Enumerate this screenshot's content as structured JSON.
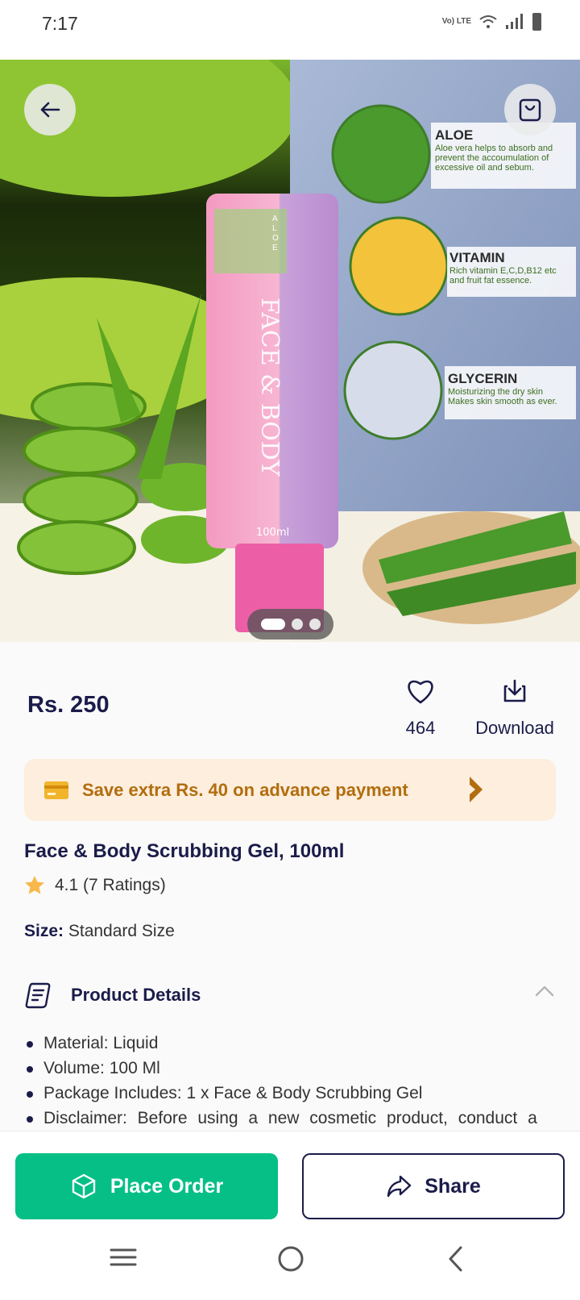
{
  "status_bar": {
    "time": "7:17",
    "network_label": "Vo) LTE"
  },
  "hero": {
    "panel_labels": [
      {
        "title": "ALOE",
        "desc_1": "Aloe vera helps to absorb and",
        "desc_2": "prevent the accoumulation of",
        "desc_3": "excessive oil and sebum."
      },
      {
        "title": "VITAMIN",
        "desc_1": "Rich vitamin E,C,D,B12 etc",
        "desc_2": "and fruit fat essence.",
        "desc_3": ""
      },
      {
        "title": "GLYCERIN",
        "desc_1": "Moisturizing the dry skin",
        "desc_2": "Makes skin smooth as ever.",
        "desc_3": ""
      }
    ],
    "tube_text": {
      "brand": "ALOE",
      "line_1": "FACE",
      "line_2": "&",
      "line_3": "BODY",
      "volume": "100ml"
    },
    "carousel": {
      "total": 3,
      "active_index": 0
    }
  },
  "product": {
    "price": "Rs. 250",
    "wishlist_count": "464",
    "download_label": "Download",
    "promo_text": "Save extra Rs. 40 on advance payment",
    "title": "Face & Body Scrubbing Gel, 100ml",
    "rating_text": "4.1 (7 Ratings)",
    "size_label": "Size:",
    "size_value": "Standard Size"
  },
  "details": {
    "heading": "Product Details",
    "items": [
      "Material: Liquid",
      "Volume: 100 Ml",
      "Package Includes: 1 x Face & Body Scrubbing Gel",
      "Disclaimer: Before using a new cosmetic product, conduct a"
    ]
  },
  "actions": {
    "place_order": "Place Order",
    "share": "Share"
  },
  "colors": {
    "primary_dark": "#1b1c4a",
    "accent_green": "#05bf86",
    "promo_bg": "#fdeedd",
    "promo_text": "#b26d0e",
    "star": "#f7b94b"
  },
  "icons": [
    "back-arrow-icon",
    "shopping-bag-icon",
    "heart-icon",
    "download-icon",
    "card-icon",
    "chevron-right-icon",
    "star-icon",
    "product-details-icon",
    "chevron-up-icon",
    "box-icon",
    "share-arrow-icon",
    "menu-icon",
    "home-circle-icon",
    "back-chevron-icon"
  ]
}
